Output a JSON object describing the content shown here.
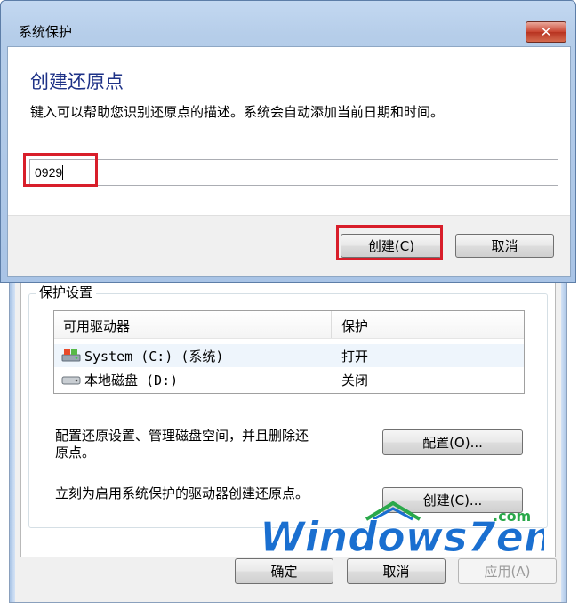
{
  "create_dialog": {
    "title": "系统保护",
    "close_glyph": "✕",
    "heading": "创建还原点",
    "description": "键入可以帮助您识别还原点的描述。系统会自动添加当前日期和时间。",
    "input_value": "0929",
    "create_button": "创建(C)",
    "cancel_button": "取消"
  },
  "system_properties": {
    "group_title": "保护设置",
    "table": {
      "columns": [
        "可用驱动器",
        "保护"
      ],
      "rows": [
        {
          "drive": "System (C:) (系统)",
          "protection": "打开",
          "icon": "system-drive-icon"
        },
        {
          "drive": "本地磁盘 (D:)",
          "protection": "关闭",
          "icon": "local-disk-icon"
        }
      ]
    },
    "configure_text": "配置还原设置、管理磁盘空间，并且删除还原点。",
    "configure_text_line1": "配置还原设置、管理磁盘空间，并且删除还",
    "configure_text_line2": "原点。",
    "configure_button": "配置(O)...",
    "create_text": "立刻为启用系统保护的驱动器创建还原点。",
    "create_button": "创建(C)...",
    "ok_button": "确定",
    "cancel_button": "取消",
    "apply_button": "应用(A)"
  },
  "watermark": {
    "text": "Windows7en",
    "suffix": ".com"
  },
  "colors": {
    "heading": "#1e3287",
    "highlight": "#d81e2a",
    "title_bar": "#b5cde9",
    "watermark_blue": "#1a6fd0",
    "watermark_green": "#2aa84a"
  }
}
